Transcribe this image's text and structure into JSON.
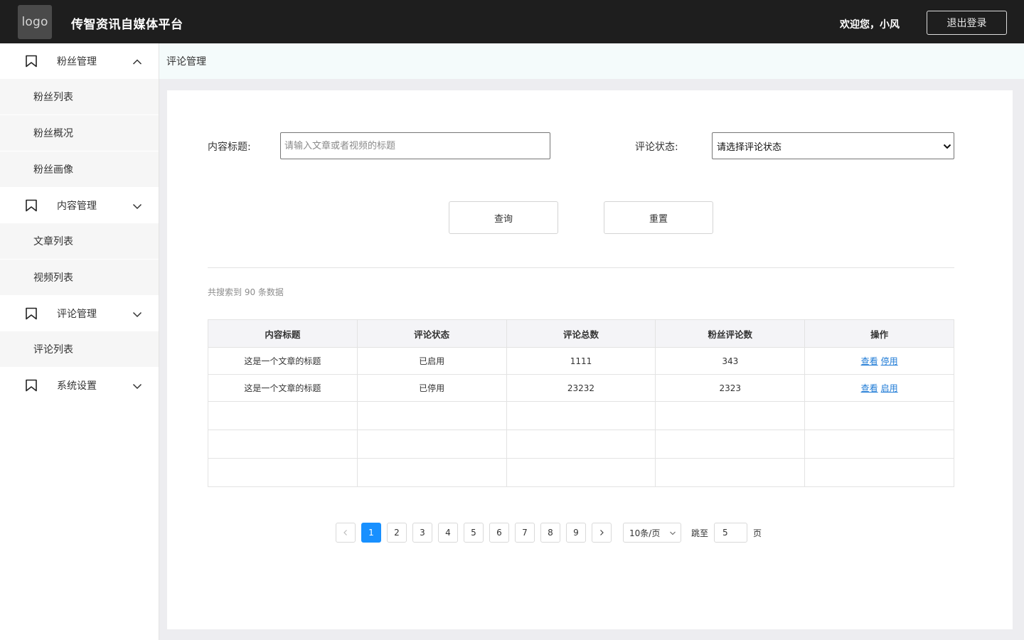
{
  "header": {
    "logo_text": "logo",
    "title": "传智资讯自媒体平台",
    "welcome": "欢迎您，小风",
    "logout_label": "退出登录",
    "bg_color": "#1e1e1e"
  },
  "sidebar": {
    "groups": [
      {
        "label": "粉丝管理",
        "icon": "bookmark-icon",
        "expanded": true,
        "items": [
          "粉丝列表",
          "粉丝概况",
          "粉丝画像"
        ]
      },
      {
        "label": "内容管理",
        "icon": "bookmark-icon",
        "expanded": false,
        "items": [
          "文章列表",
          "视频列表"
        ]
      },
      {
        "label": "评论管理",
        "icon": "bookmark-icon",
        "expanded": false,
        "items": [
          "评论列表"
        ]
      },
      {
        "label": "系统设置",
        "icon": "bookmark-icon",
        "expanded": false,
        "items": []
      }
    ]
  },
  "breadcrumb": "评论管理",
  "filters": {
    "title_label": "内容标题:",
    "title_placeholder": "请输入文章或者视频的标题",
    "title_value": "",
    "status_label": "评论状态:",
    "status_selected": "请选择评论状态",
    "query_label": "查询",
    "reset_label": "重置"
  },
  "result_text": "共搜索到 90 条数据",
  "table": {
    "headers": [
      "内容标题",
      "评论状态",
      "评论总数",
      "粉丝评论数",
      "操作"
    ],
    "rows": [
      {
        "title": "这是一个文章的标题",
        "status": "已启用",
        "total": "1111",
        "fans": "343",
        "action1": "查看",
        "action2": "停用"
      },
      {
        "title": "这是一个文章的标题",
        "status": "已停用",
        "total": "23232",
        "fans": "2323",
        "action1": "查看",
        "action2": "启用"
      }
    ],
    "empty_rows": 3
  },
  "pagination": {
    "pages": [
      "1",
      "2",
      "3",
      "4",
      "5",
      "6",
      "7",
      "8",
      "9"
    ],
    "current": "1",
    "page_size": "10条/页",
    "jump_label": "跳至",
    "jump_value": "5",
    "page_suffix": "页",
    "accent_color": "#1890ff"
  }
}
